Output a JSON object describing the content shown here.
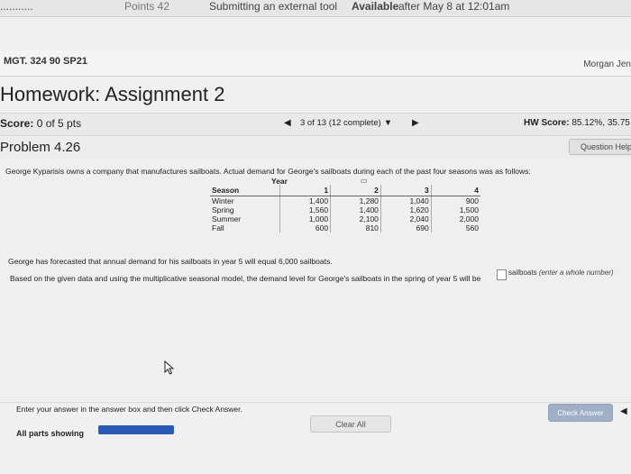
{
  "topbar": {
    "frag1": "...........",
    "points": "Points 42",
    "submitting": "Submitting an external tool",
    "available": "Available",
    "available_date": "after May 8 at 12:01am"
  },
  "course": {
    "code": "MGT. 324 90 SP21",
    "user": "Morgan Jen"
  },
  "homework": {
    "title": "Homework: Assignment 2"
  },
  "score": {
    "label": "Score:",
    "value": "0 of 5 pts",
    "progress": "3 of 13 (12 complete)",
    "hw_label": "HW Score:",
    "hw_value": "85.12%, 35.75"
  },
  "problem": {
    "title": "Problem 4.26",
    "help": "Question Help"
  },
  "content": {
    "intro": "George Kyparisis owns a company that manufactures sailboats. Actual demand for George's sailboats during each of the past four seasons was as follows:",
    "year_header": "Year",
    "forecast": "George has forecasted that annual demand for his sailboats in year 5 will equal 6,000 sailboats.",
    "question": "Based on the given data and using the multiplicative seasonal model, the demand level for George's sailboats in the spring of year 5 will be",
    "answer_unit": "sailboats",
    "answer_hint": "(enter a whole number)"
  },
  "table": {
    "columns": [
      "Season",
      "1",
      "2",
      "3",
      "4"
    ],
    "rows": [
      [
        "Winter",
        "1,400",
        "1,280",
        "1,040",
        "900"
      ],
      [
        "Spring",
        "1,560",
        "1,400",
        "1,620",
        "1,500"
      ],
      [
        "Summer",
        "1,000",
        "2,100",
        "2,040",
        "2,000"
      ],
      [
        "Fall",
        "600",
        "810",
        "690",
        "560"
      ]
    ]
  },
  "footer": {
    "enter_text": "Enter your answer in the answer box and then click Check Answer.",
    "parts_label": "All parts showing",
    "clear": "Clear All",
    "check": "Check Answer"
  },
  "icons": {
    "prev": "arrow-left",
    "next": "arrow-right",
    "dropdown": "caret-down",
    "pointer": "mouse-cursor"
  },
  "colors": {
    "parts_bar": "#2a5ab8",
    "check_button": "#9fb0c6"
  }
}
